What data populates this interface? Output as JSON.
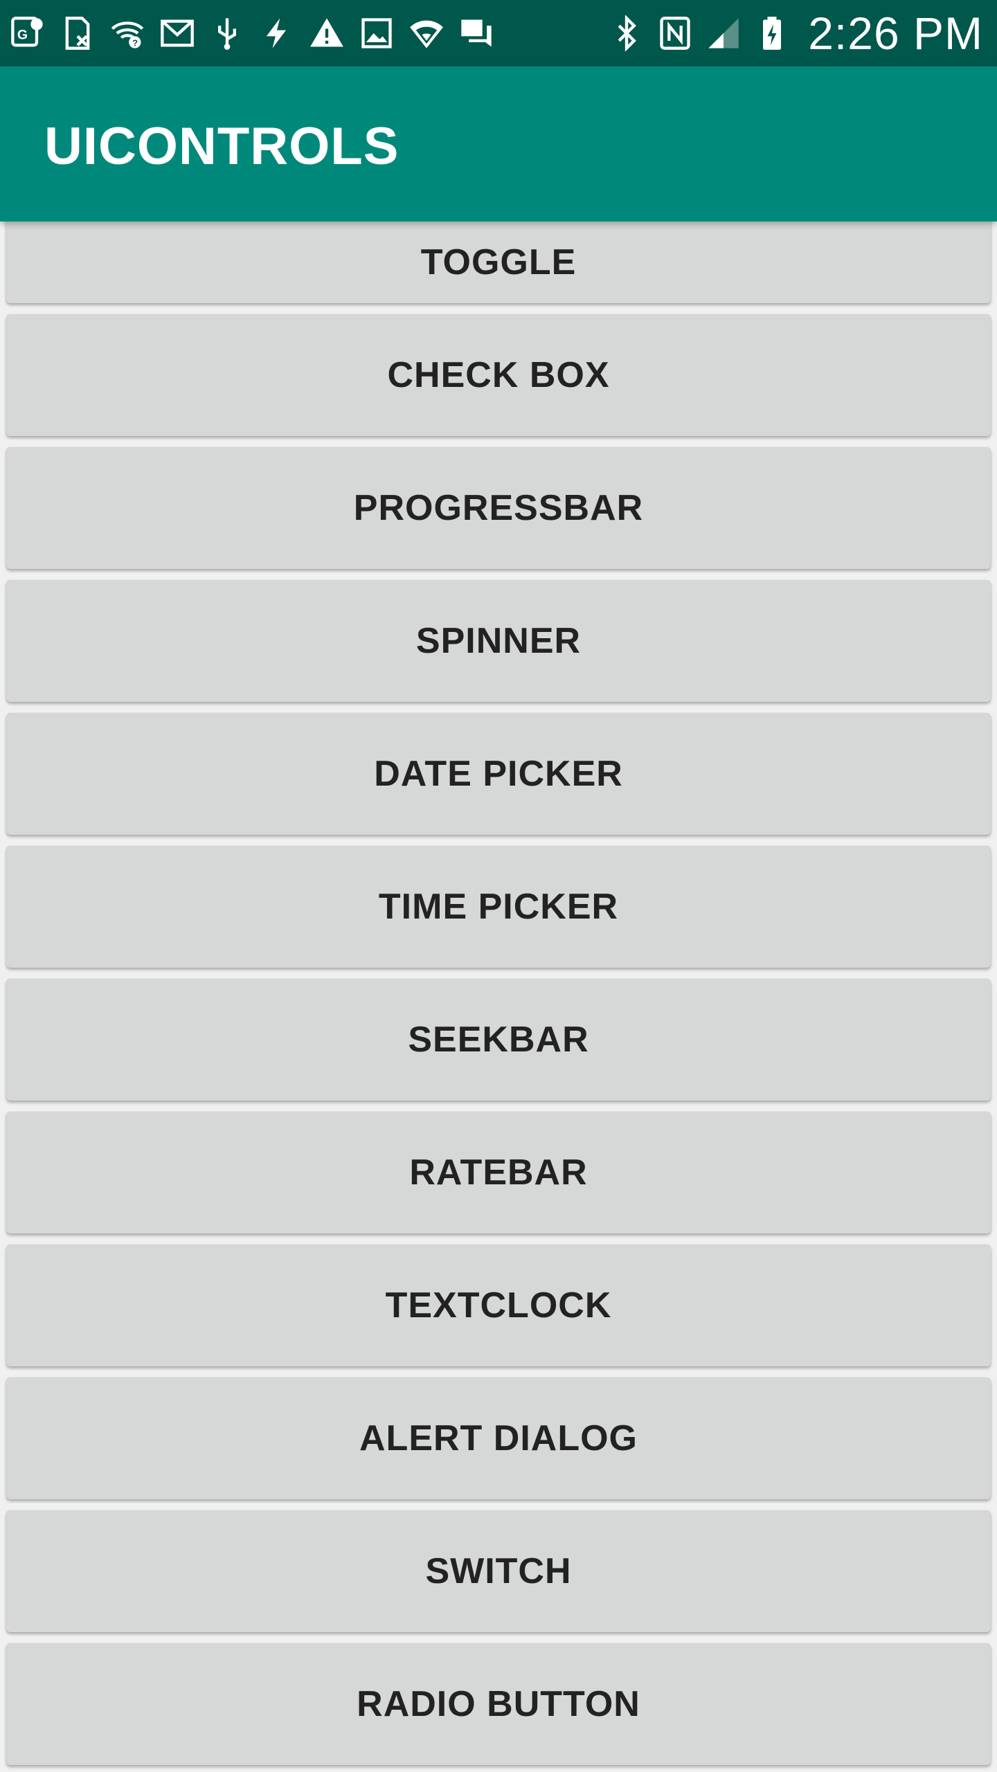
{
  "status_bar": {
    "left_icons": [
      "maps-icon",
      "sim-error-icon",
      "wifi-question-icon",
      "gmail-icon",
      "usb-icon",
      "flash-icon",
      "warning-icon",
      "image-icon",
      "wifi-shield-icon",
      "chat-icon"
    ],
    "right_icons": [
      "bluetooth-icon",
      "nfc-icon",
      "signal-icon",
      "battery-charging-icon"
    ],
    "time": "2:26 PM"
  },
  "app_bar": {
    "title": "UICONTROLS"
  },
  "buttons": [
    {
      "label": "TOGGLE"
    },
    {
      "label": "CHECK BOX"
    },
    {
      "label": "PROGRESSBAR"
    },
    {
      "label": "SPINNER"
    },
    {
      "label": "DATE PICKER"
    },
    {
      "label": "TIME PICKER"
    },
    {
      "label": "SEEKBAR"
    },
    {
      "label": "RATEBAR"
    },
    {
      "label": "TEXTCLOCK"
    },
    {
      "label": "ALERT DIALOG"
    },
    {
      "label": "SWITCH"
    },
    {
      "label": "RADIO BUTTON"
    }
  ],
  "colors": {
    "status_bar": "#00574b",
    "app_bar": "#00897b",
    "button_bg": "#d6d7d7",
    "button_text": "#222222",
    "background": "#f0f0f0"
  }
}
